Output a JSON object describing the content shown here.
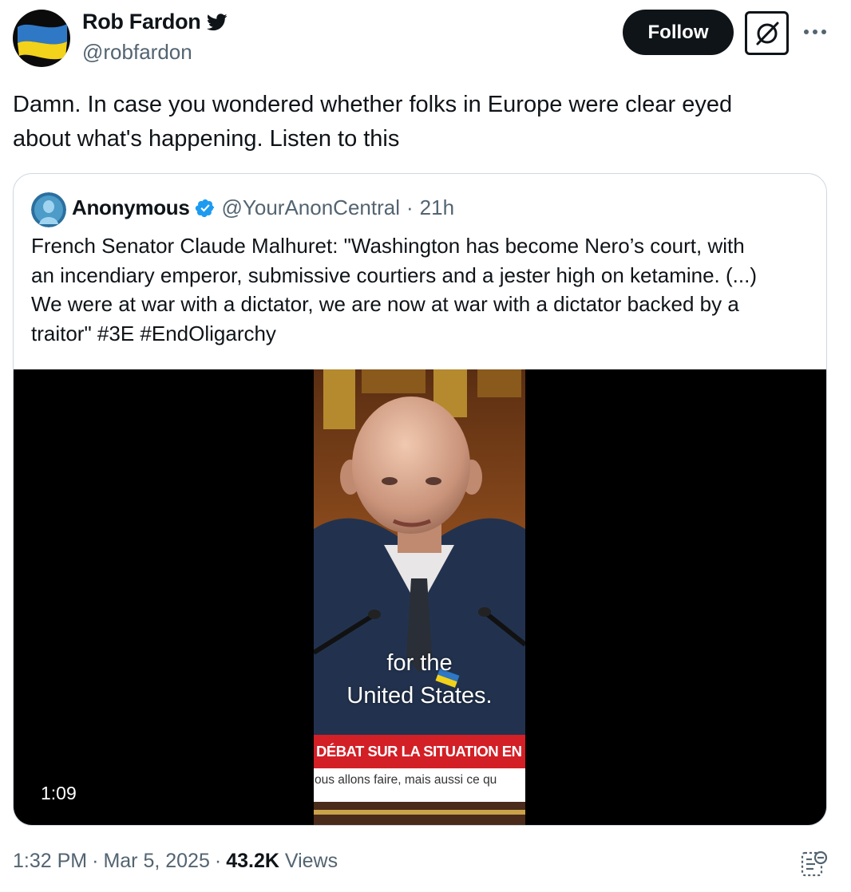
{
  "tweet": {
    "author": {
      "name": "Rob Fardon",
      "handle": "@robfardon",
      "avatar_icon": "ukraine-flag-avatar",
      "badge_icon": "twitter-bird-icon"
    },
    "actions": {
      "follow_label": "Follow",
      "grok_icon": "grok-icon",
      "more_icon": "more-icon"
    },
    "text_lines": [
      "Damn. In case you wondered whether folks in Europe were clear eyed",
      "about what's happening. Listen to this"
    ],
    "footer": {
      "time": "1:32 PM",
      "separator": "·",
      "date": "Mar 5, 2025",
      "views_count": "43.2K",
      "views_label": "Views",
      "stats_icon": "post-analytics-icon"
    }
  },
  "quote": {
    "author": {
      "name": "Anonymous",
      "handle": "@YourAnonCentral",
      "separator": "·",
      "time": "21h",
      "verified_icon": "verified-badge-icon"
    },
    "text_lines": [
      "French Senator Claude Malhuret: \"Washington has become Nero’s court, with",
      "an incendiary emperor, submissive courtiers and a jester high on ketamine. (...)",
      "We were at war with a dictator, we are now at war with a dictator backed by a",
      "traitor\" #3E #EndOligarchy"
    ],
    "video": {
      "subtitle_line1": "for the",
      "subtitle_line2": "United States.",
      "banner": "DÉBAT SUR LA SITUATION EN UKR",
      "ticker": "ous allons faire, mais aussi ce qu",
      "duration": "1:09"
    }
  },
  "colors": {
    "text_primary": "#0f1419",
    "text_secondary": "#536471",
    "verified_blue": "#1d9bf0",
    "border": "#cfd9de",
    "banner_red": "#d31f26"
  }
}
